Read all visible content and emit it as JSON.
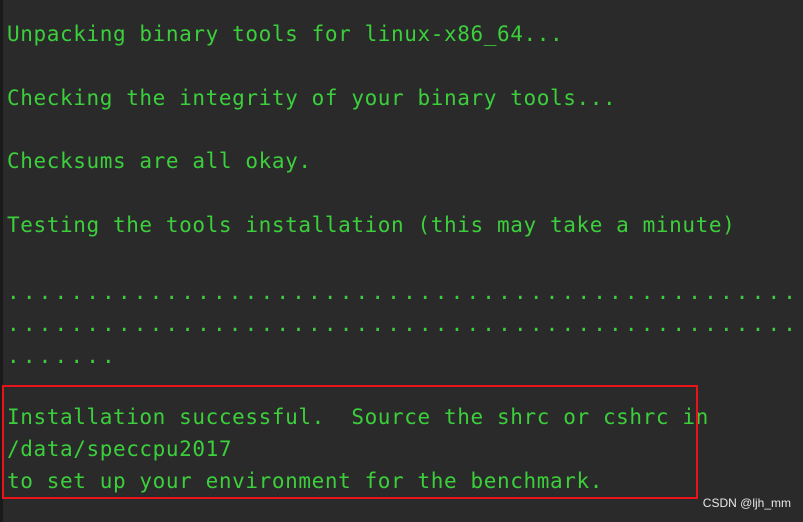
{
  "terminal": {
    "lines": {
      "unpacking": "Unpacking binary tools for linux-x86_64...",
      "checking": "Checking the integrity of your binary tools...",
      "checksums": "Checksums are all okay.",
      "testing": "Testing the tools installation (this may take a minute)",
      "dots_row1": "..........................................................",
      "dots_row2": "..........................................................",
      "dots_row3": ".......",
      "success_1": "Installation successful.  Source the shrc or cshrc in",
      "success_2": "/data/speccpu2017",
      "success_3": "to set up your environment for the benchmark."
    }
  },
  "watermark": {
    "text": "CSDN @ljh_mm"
  },
  "colors": {
    "background": "#2a2a2a",
    "text_green": "#3ccf3c",
    "highlight_red": "#e8141a",
    "watermark": "#e8e8e8"
  }
}
